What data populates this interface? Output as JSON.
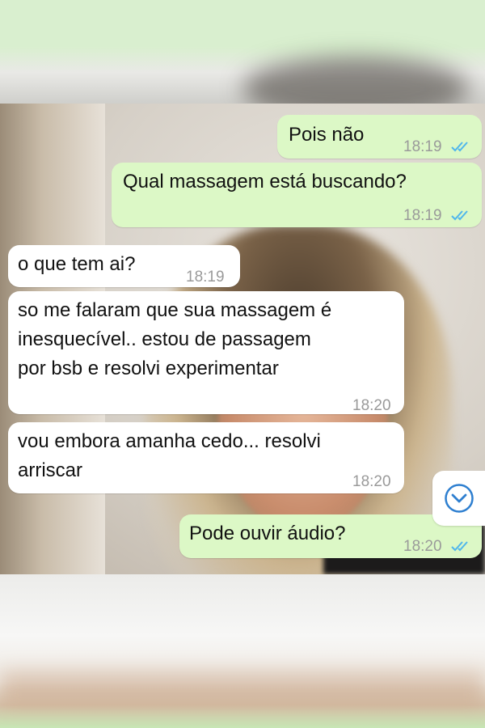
{
  "conversation": {
    "messages": [
      {
        "direction": "out",
        "text": "Pois não",
        "time": "18:19",
        "status": "read"
      },
      {
        "direction": "out",
        "text": "Qual massagem está buscando?",
        "time": "18:19",
        "status": "read"
      },
      {
        "direction": "in",
        "text": "o que tem ai?",
        "time": "18:19"
      },
      {
        "direction": "in",
        "text_lines": [
          "so me falaram que sua massagem é",
          "inesquecível.. estou de passagem",
          "por bsb e resolvi experimentar"
        ],
        "time": "18:20"
      },
      {
        "direction": "in",
        "text_lines": [
          "vou embora amanha cedo... resolvi",
          "arriscar"
        ],
        "time": "18:20"
      },
      {
        "direction": "out",
        "text": "Pode ouvir áudio?",
        "time": "18:20",
        "status": "read"
      }
    ]
  },
  "icons": {
    "read_receipt": "double-check-icon",
    "scroll_down": "chevron-down-circle-icon"
  },
  "colors": {
    "outgoing_bubble": "#dcf8c6",
    "incoming_bubble": "#ffffff",
    "read_check": "#4fb6ec",
    "scroll_icon": "#2e7fd0"
  }
}
